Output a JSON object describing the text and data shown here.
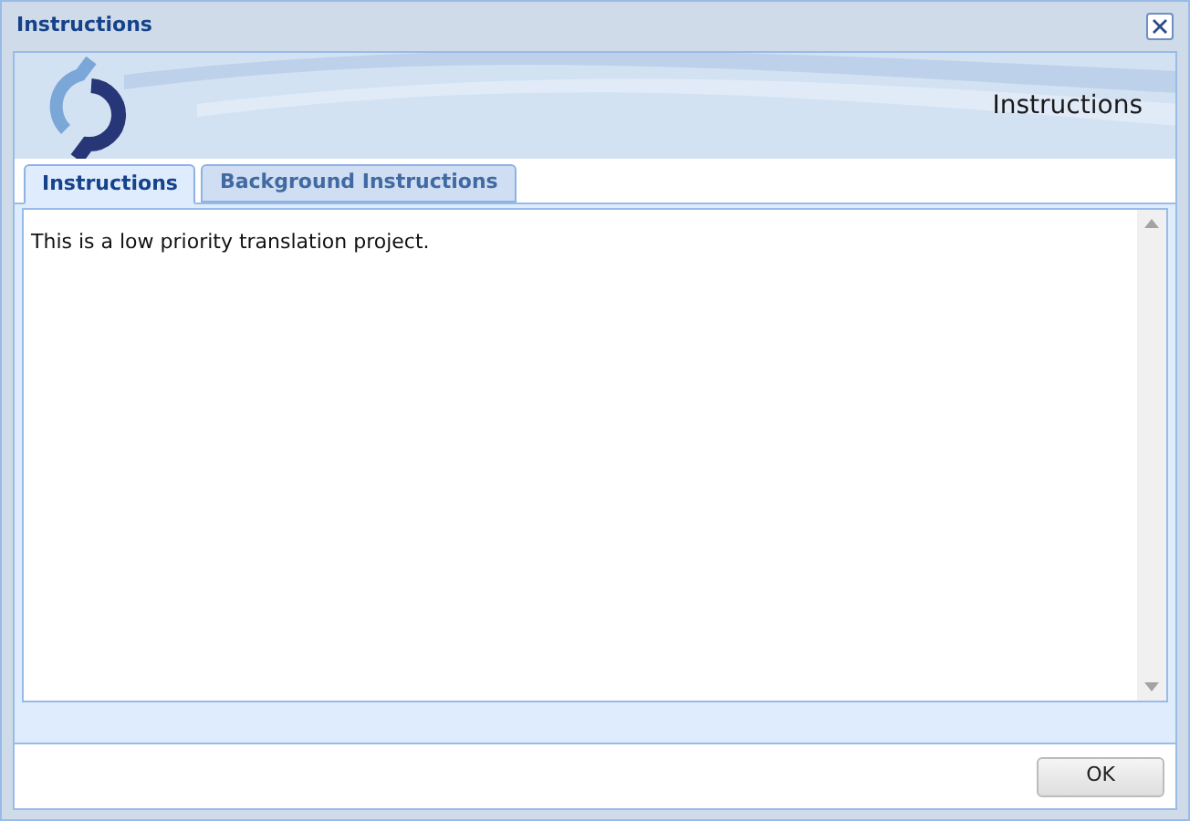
{
  "window": {
    "title": "Instructions"
  },
  "banner": {
    "title": "Instructions"
  },
  "tabs": [
    {
      "label": "Instructions",
      "selected": true
    },
    {
      "label": "Background Instructions",
      "selected": false
    }
  ],
  "content": {
    "text": "This is a low priority translation project."
  },
  "buttons": [
    "OK"
  ]
}
